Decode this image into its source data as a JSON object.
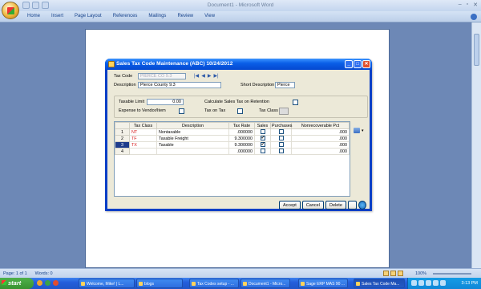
{
  "word": {
    "title": "Document1 - Microsoft Word",
    "tabs": [
      "Home",
      "Insert",
      "Page Layout",
      "References",
      "Mailings",
      "Review",
      "View"
    ],
    "win_controls": [
      "–",
      "▫",
      "✕"
    ]
  },
  "status_bar": {
    "page": "Page: 1 of 1",
    "words": "Words: 0",
    "zoom": "100%"
  },
  "taskbar": {
    "start_label": "start",
    "tasks": [
      {
        "label": "Welcome, Mike! | L..."
      },
      {
        "label": "blogs"
      },
      {
        "label": "Tax Codes setup - ..."
      },
      {
        "label": "Document1 - Micro..."
      },
      {
        "label": "Sage ERP MAS 90 ..."
      },
      {
        "label": "Sales Tax Code Ma..."
      }
    ],
    "clock": "3:13 PM"
  },
  "dialog": {
    "title": "Sales Tax Code Maintenance (ABC) 10/24/2012",
    "tax_code_label": "Tax Code",
    "tax_code_value": "PIERCE CO 9.3",
    "description_label": "Description",
    "description_value": "Pierce County 9.3",
    "short_description_label": "Short Description",
    "short_description_value": "Pierce",
    "taxable_limit_label": "Taxable Limit",
    "taxable_limit_value": "0.00",
    "calc_retention_label": "Calculate Sales Tax on Retention",
    "expense_vendor_label": "Expense to Vendor/Item",
    "tax_on_tax_label": "Tax on Tax",
    "tax_class_label": "Tax Class",
    "nav_glyphs": [
      "|◀",
      "◀",
      "▶",
      "▶|"
    ],
    "grid": {
      "headers": [
        "",
        "Tax Class",
        "Description",
        "Tax Rate",
        "Sales",
        "Purchases",
        "Nonrecoverable Pct"
      ],
      "rows": [
        {
          "num": "1",
          "code": "NT",
          "description": "Nontaxable",
          "rate": ".000000",
          "sales": false,
          "purchases": false,
          "nonrec": ".000"
        },
        {
          "num": "2",
          "code": "TF",
          "description": "Taxable Freight",
          "rate": "9.300000",
          "sales": true,
          "purchases": false,
          "nonrec": ".000"
        },
        {
          "num": "3",
          "code": "TX",
          "description": "Taxable",
          "rate": "9.300000",
          "sales": true,
          "purchases": false,
          "nonrec": ".000"
        },
        {
          "num": "4",
          "code": "",
          "description": "",
          "rate": ".000000",
          "sales": false,
          "purchases": false,
          "nonrec": ".000"
        }
      ]
    },
    "buttons": {
      "accept": "Accept",
      "cancel": "Cancel",
      "delete": "Delete"
    }
  },
  "colors": {
    "dialog_title": "#0a5fe8",
    "selected_row": "#1e3c8c",
    "tax_class_code": "#d51818"
  },
  "icons": [
    "office-button-icon",
    "save-icon",
    "undo-icon",
    "redo-icon",
    "printer-icon",
    "help-icon",
    "grid-options-icon"
  ]
}
